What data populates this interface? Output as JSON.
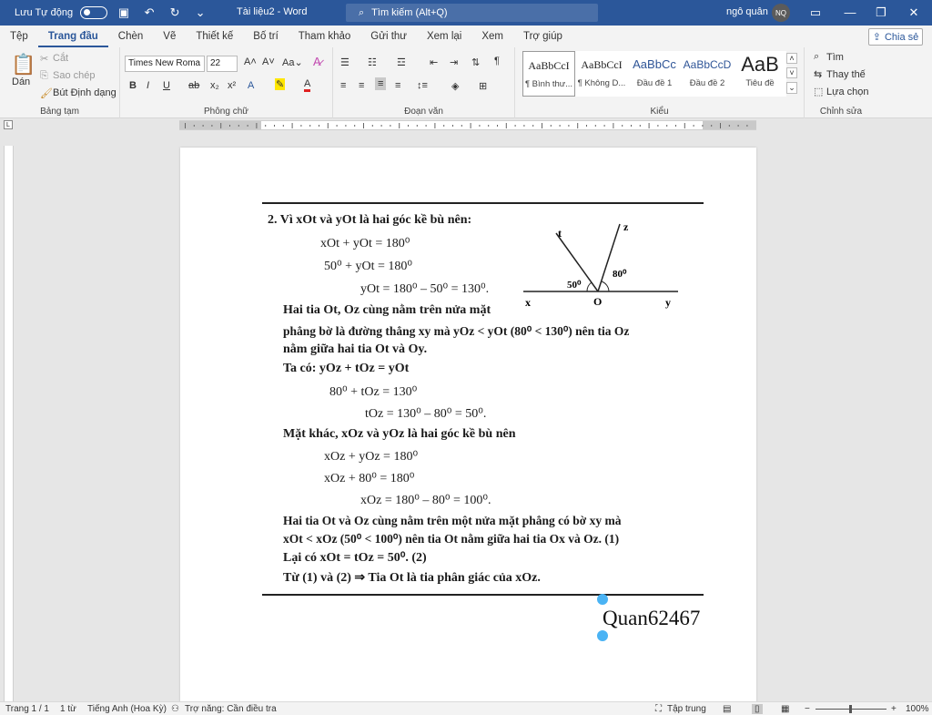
{
  "titlebar": {
    "autosave_label": "Lưu Tự động",
    "doc_title": "Tài liệu2  -  Word",
    "search_placeholder": "Tìm kiếm (Alt+Q)",
    "user_name": "ngô quân",
    "user_initials": "NQ"
  },
  "tabs": [
    "Tệp",
    "Trang đầu",
    "Chèn",
    "Vẽ",
    "Thiết kế",
    "Bố trí",
    "Tham khảo",
    "Gửi thư",
    "Xem lại",
    "Xem",
    "Trợ giúp"
  ],
  "share_label": "Chia sẻ",
  "ribbon": {
    "clipboard": {
      "paste": "Dán",
      "cut": "Cắt",
      "copy": "Sao chép",
      "format_painter": "Bút Định dạng",
      "label": "Bảng tạm"
    },
    "font": {
      "family": "Times New Roma",
      "size": "22",
      "label": "Phông chữ"
    },
    "paragraph": {
      "label": "Đoạn văn"
    },
    "styles": {
      "items": [
        {
          "preview": "AaBbCcI",
          "name": "¶ Bình thư..."
        },
        {
          "preview": "AaBbCcI",
          "name": "¶ Không D..."
        },
        {
          "preview": "AaBbCc",
          "name": "Đầu đề 1"
        },
        {
          "preview": "AaBbCcD",
          "name": "Đầu đề 2"
        },
        {
          "preview": "AaB",
          "name": "Tiêu đề"
        }
      ],
      "label": "Kiểu"
    },
    "editing": {
      "find": "Tìm",
      "replace": "Thay thế",
      "select": "Lựa chọn",
      "label": "Chỉnh sửa"
    }
  },
  "document": {
    "lines": [
      "2. Vì xOt và yOt là hai góc kề bù nên:",
      "xOt + yOt = 180⁰",
      "50⁰ + yOt = 180⁰",
      "yOt = 180⁰ – 50⁰ = 130⁰.",
      "Hai tia Ot, Oz cùng nằm trên nửa mặt",
      "phẳng bờ là đường thẳng xy mà yOz < yOt (80⁰ < 130⁰) nên tia Oz",
      "nằm giữa hai tia Ot và Oy.",
      "Ta có: yOz + tOz = yOt",
      "80⁰ + tOz = 130⁰",
      "tOz = 130⁰ – 80⁰ = 50⁰.",
      "Mặt khác, xOz và yOz là hai góc kề bù nên",
      "xOz + yOz = 180⁰",
      "xOz + 80⁰ = 180⁰",
      "xOz = 180⁰ – 80⁰ = 100⁰.",
      "Hai tia Ot và Oz cùng nằm trên một nửa mặt phẳng có bờ xy mà",
      "xOt < xOz (50⁰ < 100⁰) nên tia Ot nằm giữa hai tia Ox và Oz. (1)",
      "Lại có xOt = tOz = 50⁰. (2)",
      "Từ (1) và (2) ⇒ Tia Ot là tia phân giác của xOz."
    ],
    "figure": {
      "t": "t",
      "z": "z",
      "x": "x",
      "o": "O",
      "y": "y",
      "angle1": "50⁰",
      "angle2": "80⁰"
    },
    "watermark": "Quan62467"
  },
  "status": {
    "page": "Trang 1 / 1",
    "words": "1 từ",
    "language": "Tiếng Anh (Hoa Kỳ)",
    "accessibility": "Trợ năng: Cần điều tra",
    "focus": "Tập trung",
    "zoom": "100%"
  },
  "colors": {
    "title_bar": "#2b579a",
    "accent": "#2b579a",
    "selection_handle": "#4ab3f4"
  }
}
